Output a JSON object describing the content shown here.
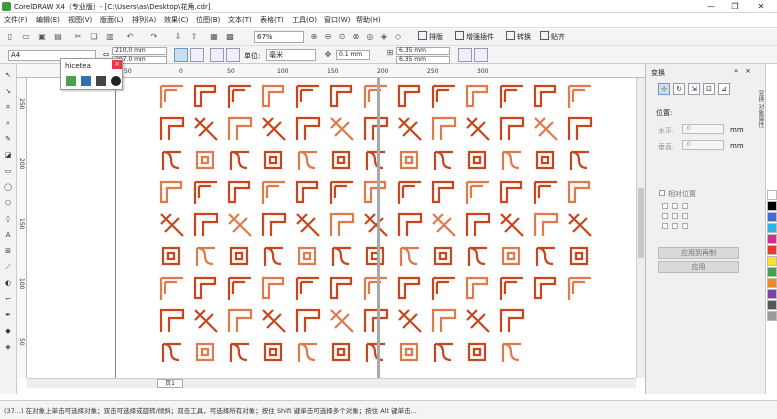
{
  "window": {
    "title": "CorelDRAW X4（专业版）- [C:\\Users\\as\\Desktop\\花角.cdr]",
    "minimize_glyph": "—",
    "maximize_glyph": "❐",
    "close_glyph": "✕"
  },
  "menu": {
    "items": [
      "文件(F)",
      "编辑(E)",
      "视图(V)",
      "版面(L)",
      "排列(A)",
      "效果(C)",
      "位图(B)",
      "文本(T)",
      "表格(T)",
      "工具(O)",
      "窗口(W)",
      "帮助(H)"
    ]
  },
  "toolbar": {
    "zoom": "67%",
    "buttons": [
      "排版",
      "增强插件",
      "转换",
      "贴齐"
    ]
  },
  "property_bar": {
    "page_size": "A4",
    "width": "210.0 mm",
    "height": "297.0 mm",
    "unit_label": "单位:",
    "unit_value": "毫米",
    "nudge": "0.1 mm",
    "dup_x": "6.35 mm",
    "dup_y": "6.35 mm"
  },
  "ruler": {
    "top_ticks": [
      "100",
      "50",
      "0",
      "50",
      "100",
      "150",
      "200",
      "250",
      "300"
    ],
    "left_ticks": [
      "250",
      "200",
      "150",
      "100",
      "50"
    ]
  },
  "float_panel": {
    "title": "hicetea",
    "close_glyph": "×"
  },
  "docker": {
    "title": "变换",
    "position_label": "位置:",
    "h_label": "水平:",
    "v_label": "垂直:",
    "h_value": ".0",
    "v_value": ".0",
    "unit": "mm",
    "relative_label": "相对位置",
    "apply_copy_label": "应用到再制",
    "apply_label": "应用"
  },
  "side_tabs": [
    "变换",
    "对象属性"
  ],
  "page_tab": "页1",
  "status": {
    "text": "(37...) 在对象上单击可选择对象；双击可选择或旋转/倾斜；双击工具，可选择所有对象；按住 Shift 键单击可选择多个对象；按住 Alt 键单击..."
  },
  "colors": {
    "accent": "#c8461d",
    "accent_light": "#e07a4d"
  }
}
